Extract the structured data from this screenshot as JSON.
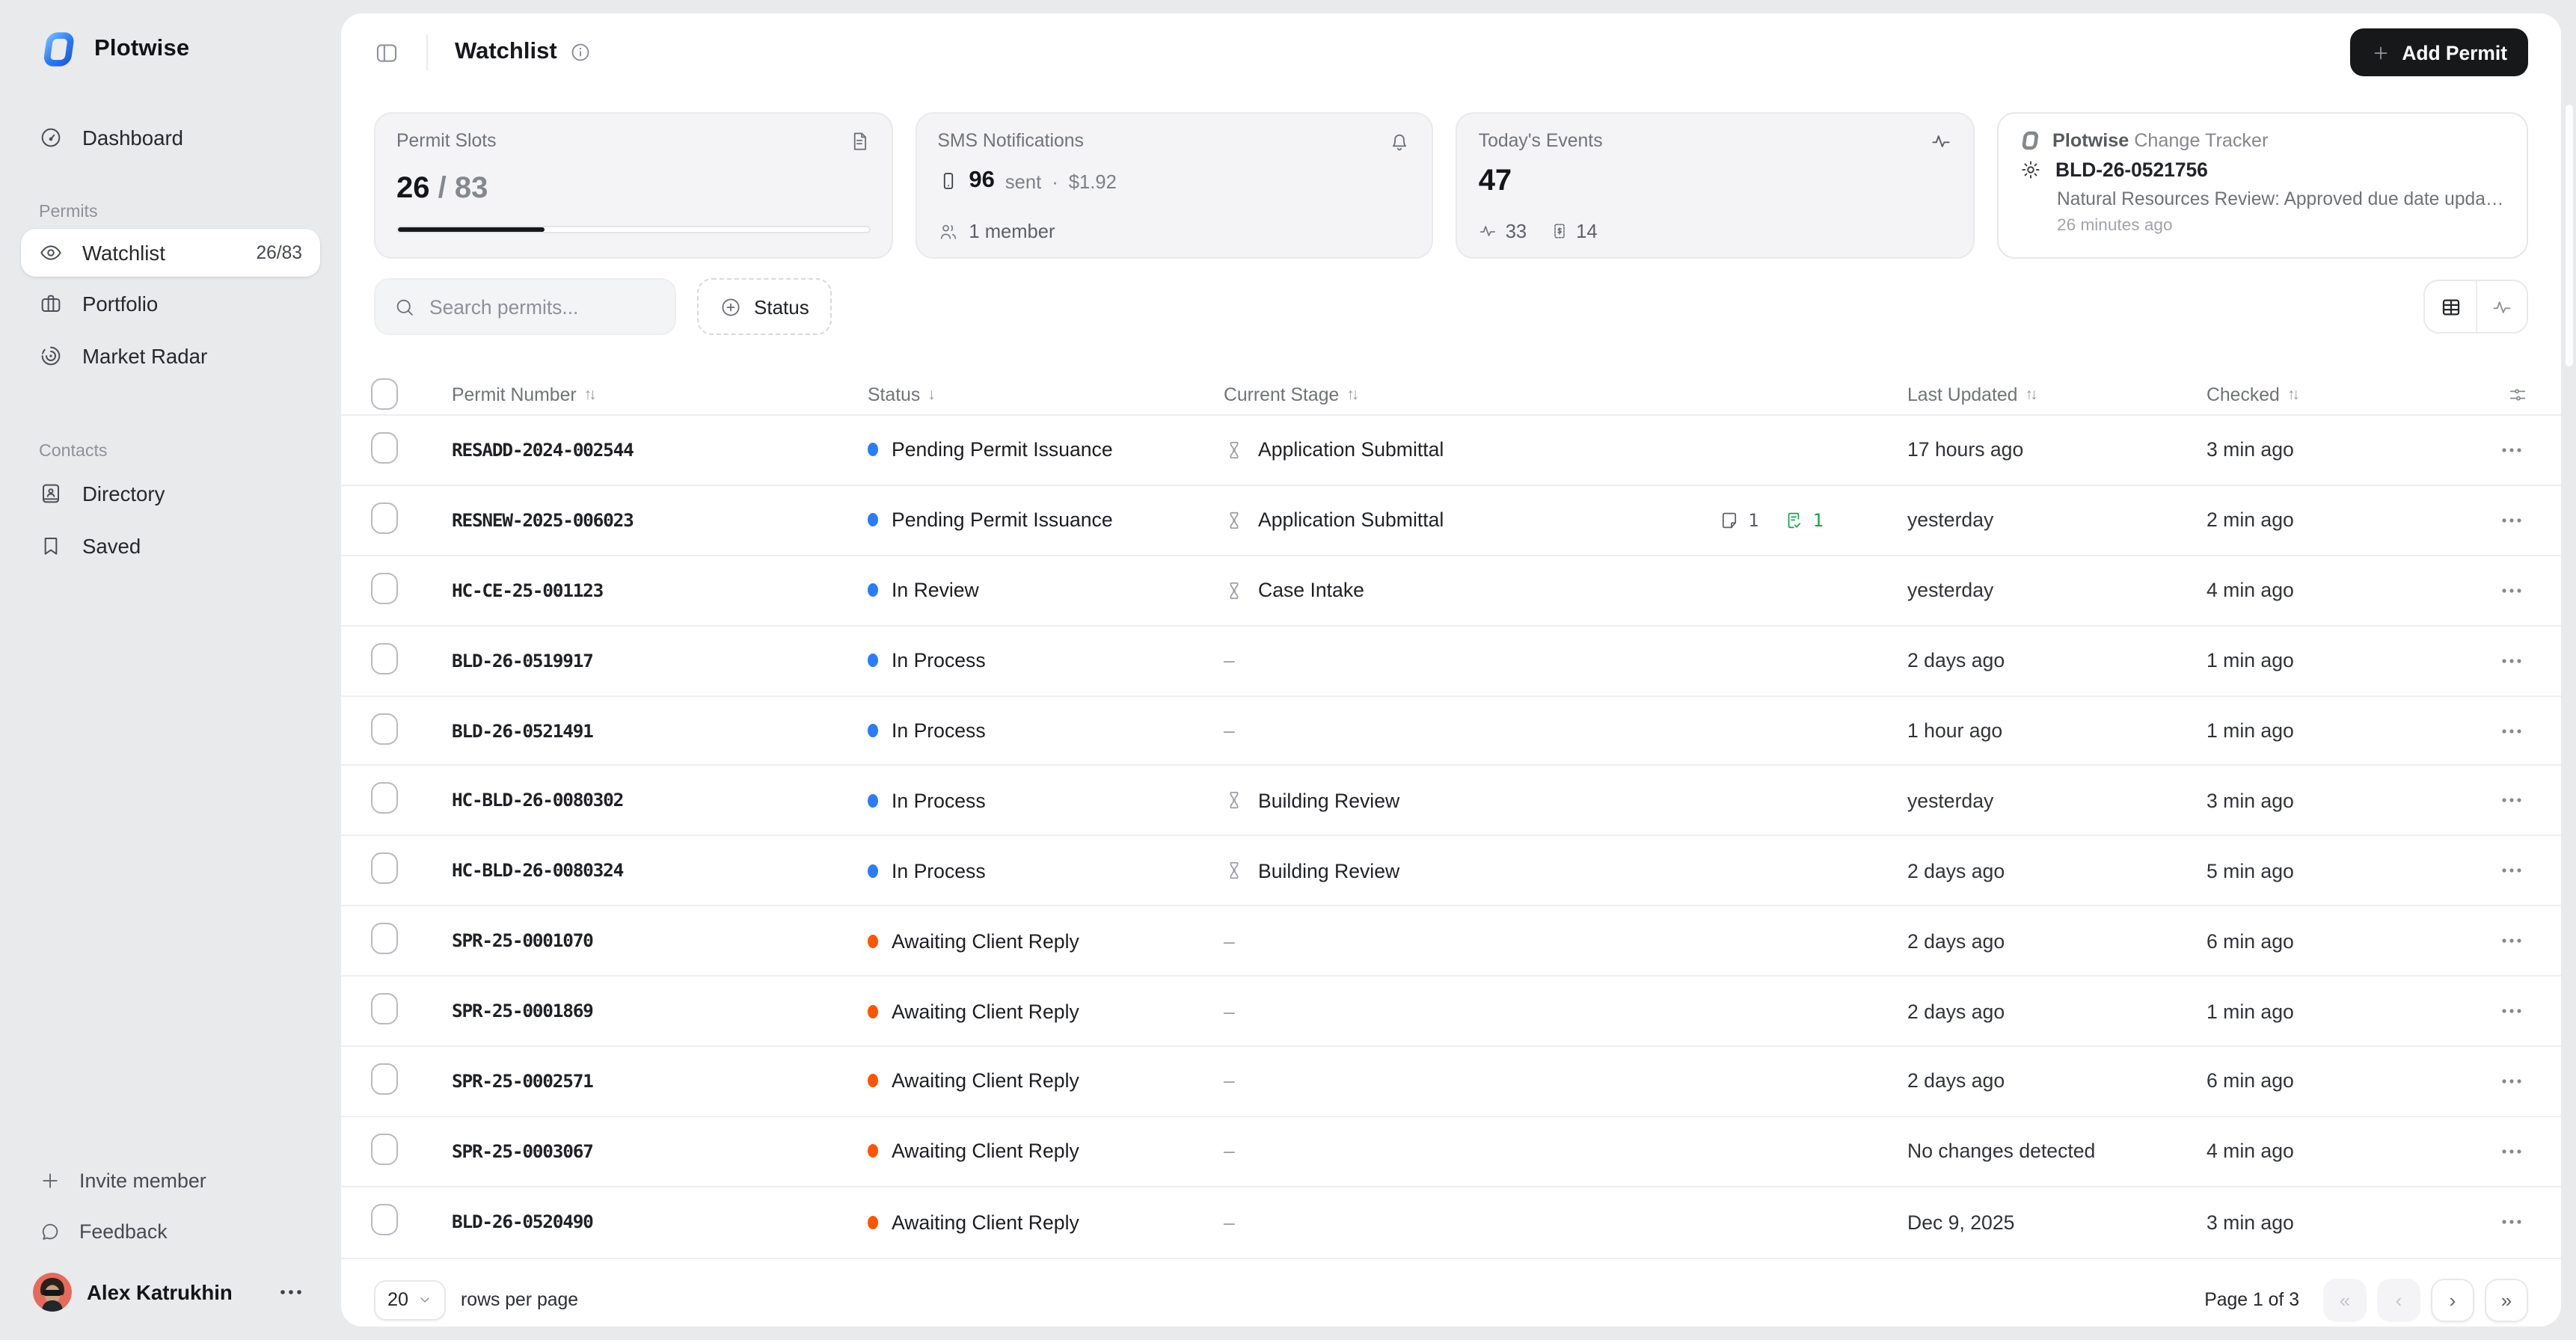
{
  "theme": {
    "status_blue": "#2b7cf7",
    "status_orange": "#ff5500",
    "badge_green": "#18a349",
    "accent_dark": "#17181a"
  },
  "brand": {
    "name": "Plotwise"
  },
  "sidebar": {
    "dashboard_label": "Dashboard",
    "permits_section": "Permits",
    "watchlist_label": "Watchlist",
    "watchlist_badge": "26/83",
    "portfolio_label": "Portfolio",
    "market_radar_label": "Market Radar",
    "contacts_section": "Contacts",
    "directory_label": "Directory",
    "saved_label": "Saved",
    "invite_label": "Invite member",
    "feedback_label": "Feedback",
    "user_name": "Alex Katrukhin"
  },
  "header": {
    "title": "Watchlist",
    "add_permit_label": "Add Permit"
  },
  "cards": {
    "permit_slots": {
      "title": "Permit Slots",
      "used": "26",
      "total_display": "/ 83",
      "progress_pct": 31.3
    },
    "sms": {
      "title": "SMS Notifications",
      "count": "96",
      "sent_label": "sent",
      "separator": "·",
      "cost": "$1.92",
      "members": "1 member"
    },
    "events": {
      "title": "Today's Events",
      "count": "47",
      "activity_count": "33",
      "invoice_count": "14"
    },
    "tracker": {
      "brand": "Plotwise",
      "product": "Change Tracker",
      "permit": "BLD-26-0521756",
      "description": "Natural Resources Review: Approved due date update…",
      "time": "26 minutes ago"
    }
  },
  "filters": {
    "search_placeholder": "Search permits...",
    "status_label": "Status"
  },
  "table": {
    "columns": [
      "Permit Number",
      "Status",
      "Current Stage",
      "Last Updated",
      "Checked"
    ],
    "empty_stage": "–",
    "rows": [
      {
        "number": "RESADD-2024-002544",
        "status": "Pending Permit Issuance",
        "tone": "blue",
        "stage": "Application Submittal",
        "notes": null,
        "approvals": null,
        "updated": "17 hours ago",
        "checked": "3 min ago"
      },
      {
        "number": "RESNEW-2025-006023",
        "status": "Pending Permit Issuance",
        "tone": "blue",
        "stage": "Application Submittal",
        "notes": "1",
        "approvals": "1",
        "updated": "yesterday",
        "checked": "2 min ago"
      },
      {
        "number": "HC-CE-25-001123",
        "status": "In Review",
        "tone": "blue",
        "stage": "Case Intake",
        "notes": null,
        "approvals": null,
        "updated": "yesterday",
        "checked": "4 min ago"
      },
      {
        "number": "BLD-26-0519917",
        "status": "In Process",
        "tone": "blue",
        "stage": "",
        "notes": null,
        "approvals": null,
        "updated": "2 days ago",
        "checked": "1 min ago"
      },
      {
        "number": "BLD-26-0521491",
        "status": "In Process",
        "tone": "blue",
        "stage": "",
        "notes": null,
        "approvals": null,
        "updated": "1 hour ago",
        "checked": "1 min ago"
      },
      {
        "number": "HC-BLD-26-0080302",
        "status": "In Process",
        "tone": "blue",
        "stage": "Building Review",
        "notes": null,
        "approvals": null,
        "updated": "yesterday",
        "checked": "3 min ago"
      },
      {
        "number": "HC-BLD-26-0080324",
        "status": "In Process",
        "tone": "blue",
        "stage": "Building Review",
        "notes": null,
        "approvals": null,
        "updated": "2 days ago",
        "checked": "5 min ago"
      },
      {
        "number": "SPR-25-0001070",
        "status": "Awaiting Client Reply",
        "tone": "orange",
        "stage": "",
        "notes": null,
        "approvals": null,
        "updated": "2 days ago",
        "checked": "6 min ago"
      },
      {
        "number": "SPR-25-0001869",
        "status": "Awaiting Client Reply",
        "tone": "orange",
        "stage": "",
        "notes": null,
        "approvals": null,
        "updated": "2 days ago",
        "checked": "1 min ago"
      },
      {
        "number": "SPR-25-0002571",
        "status": "Awaiting Client Reply",
        "tone": "orange",
        "stage": "",
        "notes": null,
        "approvals": null,
        "updated": "2 days ago",
        "checked": "6 min ago"
      },
      {
        "number": "SPR-25-0003067",
        "status": "Awaiting Client Reply",
        "tone": "orange",
        "stage": "",
        "notes": null,
        "approvals": null,
        "updated": "No changes detected",
        "checked": "4 min ago"
      },
      {
        "number": "BLD-26-0520490",
        "status": "Awaiting Client Reply",
        "tone": "orange",
        "stage": "",
        "notes": null,
        "approvals": null,
        "updated": "Dec 9, 2025",
        "checked": "3 min ago"
      }
    ]
  },
  "pagination": {
    "page_size": "20",
    "rows_label": "rows per page",
    "page_info": "Page 1 of 3"
  }
}
